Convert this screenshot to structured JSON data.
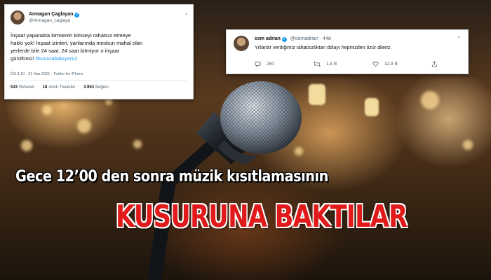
{
  "tweet_left": {
    "name": "Armagan Çaglayan",
    "handle": "@Armagan_caglaya",
    "text_lines": [
      "İnşaat yaparakta kimsenin kimseyi rahatsız etmeye",
      "hakkı yok! İnşaat izinleri, yanlarında meskun mahal olan",
      "yerlerde bile 24 saat. 24 saat bitmiyor o inşaat",
      "gürültüsü!"
    ],
    "hashtag": "#kusurabakıyoruz",
    "timestamp": "ÖS 8:10 · 21 Haz 2021 · Twitter for iPhone",
    "retweets_count": "533",
    "retweets_label": "Retweet",
    "quotes_count": "18",
    "quotes_label": "Alıntı Tweetler",
    "likes_count": "3.953",
    "likes_label": "Beğeni",
    "icons": {
      "verified": "verified-badge-icon",
      "more": "chevron-down-icon"
    }
  },
  "tweet_right": {
    "name": "cem adrian",
    "handle": "@cemadrian",
    "age": "· 44d",
    "text": "Yıllardır verdiğimiz rahatsızlıktan dolayı hepinizden özür dileriz.",
    "replies": "260",
    "retweets": "1,8 B",
    "likes": "12,8 B",
    "icons": {
      "verified": "verified-badge-icon",
      "reply": "reply-icon",
      "retweet": "retweet-icon",
      "like": "heart-icon",
      "share": "share-icon",
      "more": "more-icon"
    }
  },
  "subtitle": "Gece 12’00 den sonra müzik kısıtlamasının",
  "headline": "KUSURUNA BAKTILAR",
  "colors": {
    "headline": "#e01a1a",
    "subtitle": "#ffffff",
    "twitter_blue": "#1d9bf0"
  }
}
